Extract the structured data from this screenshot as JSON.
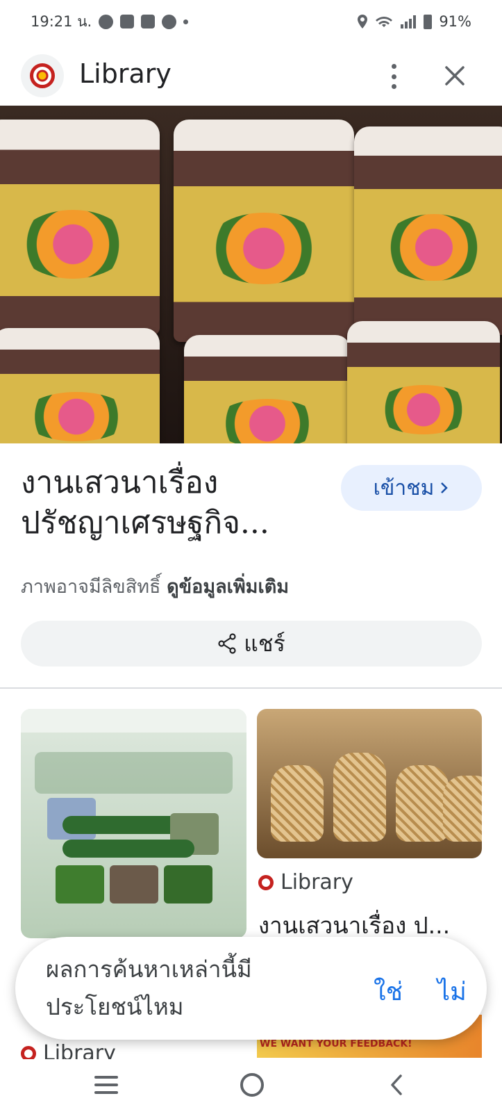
{
  "status_bar": {
    "time": "19:21 น.",
    "battery": "91%",
    "icons": [
      "messenger-icon",
      "mail-icon",
      "mail-icon",
      "compass-icon",
      "dot-icon",
      "location-icon",
      "wifi-icon",
      "signal-icon",
      "battery-icon"
    ]
  },
  "header": {
    "title": "Library",
    "icons": [
      "library-logo-icon",
      "more-vert-icon",
      "close-icon"
    ]
  },
  "result": {
    "title_line1": "งานเสวนาเรื่อง",
    "title_line2": "ปรัชญาเศรษฐกิจ...",
    "visit_label": "เข้าชม",
    "copyright_text": "ภาพอาจมีลิขสิทธิ์",
    "more_info_link": "ดูข้อมูลเพิ่มเติม",
    "share_label": "แชร์"
  },
  "related": {
    "items": [
      {
        "source": "Library",
        "title": "งานเสวนาเรื่อง ป..."
      },
      {
        "source": "Library",
        "title": ""
      }
    ],
    "banner_text": "WE WANT YOUR FEEDBACK!"
  },
  "feedback": {
    "question": "ผลการค้นหาเหล่านี้มีประโยชน์ไหม",
    "yes_label": "ใช่",
    "no_label": "ไม่"
  },
  "colors": {
    "accent_blue": "#1a73e8",
    "visit_bg": "#e8f0fe",
    "chip_bg": "#f1f3f4",
    "logo_red": "#c5221f"
  }
}
